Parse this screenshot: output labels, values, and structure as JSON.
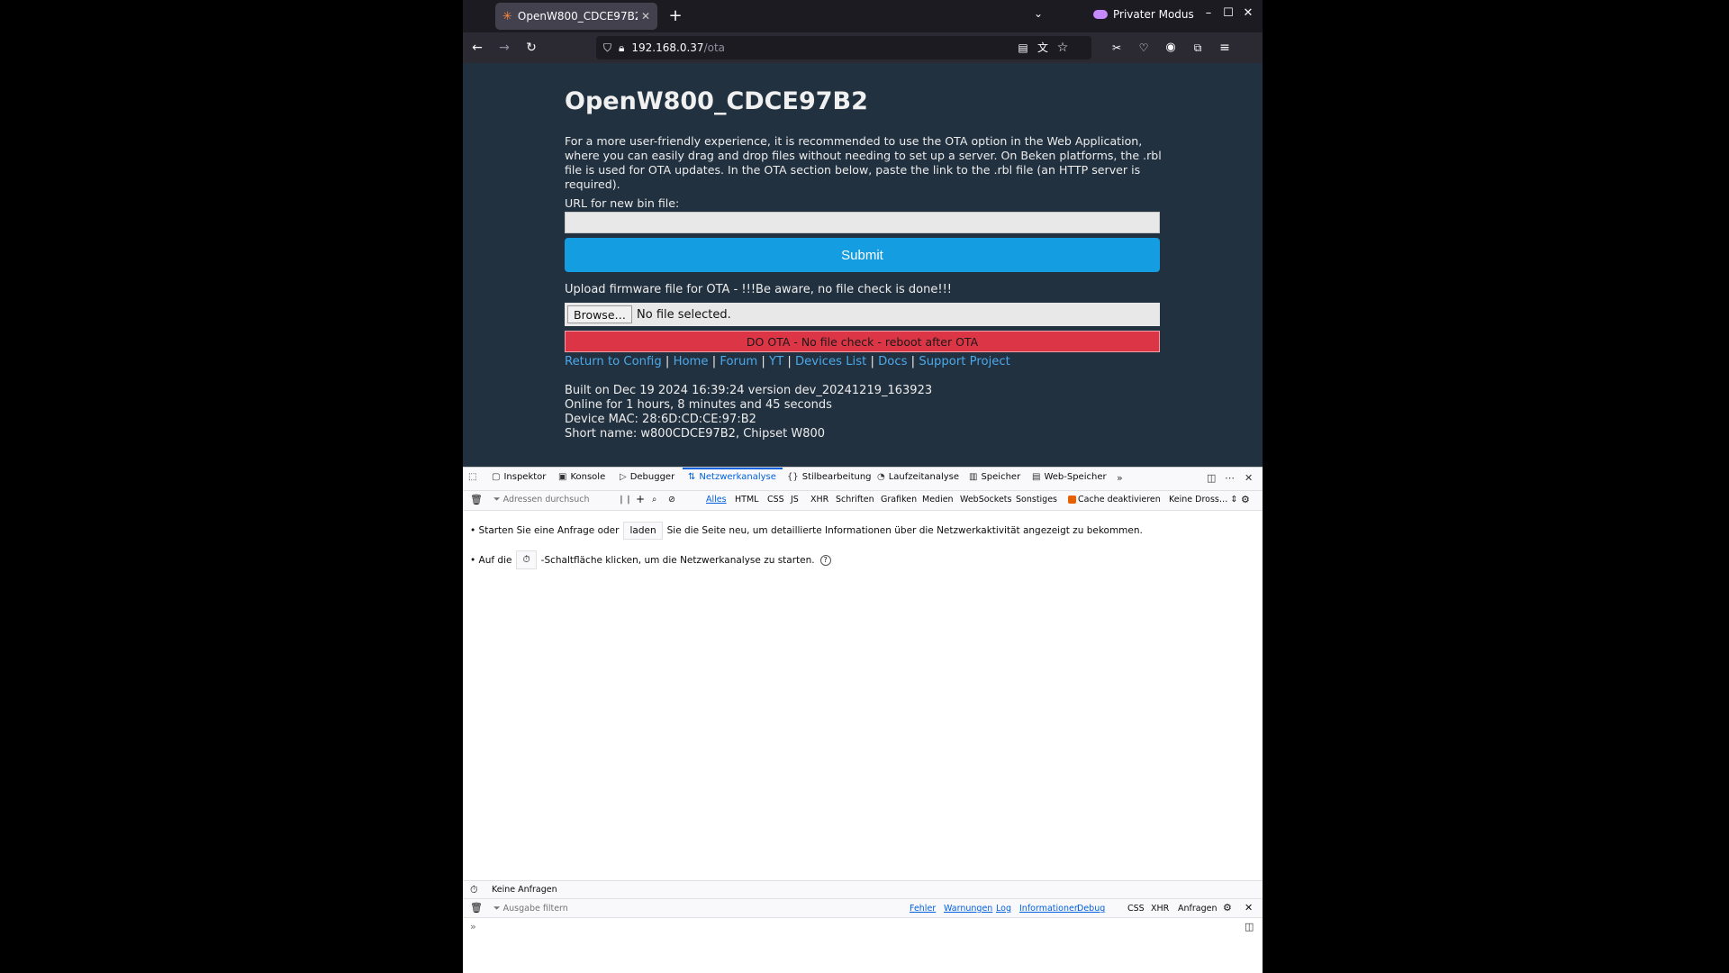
{
  "browser": {
    "tab_title": "OpenW800_CDCE97B2",
    "private_label": "Privater Modus",
    "url_host": "192.168.0.37",
    "url_path": "/ota"
  },
  "page": {
    "title": "OpenW800_CDCE97B2",
    "intro": "For a more user-friendly experience, it is recommended to use the OTA option in the Web Application, where you can easily drag and drop files without needing to set up a server. On Beken platforms, the .rbl file is used for OTA updates. In the OTA section below, paste the link to the .rbl file (an HTTP server is required).",
    "url_label": "URL for new bin file:",
    "url_value": "",
    "submit_label": "Submit",
    "upload_label": "Upload firmware file for OTA - !!!Be aware, no file check is done!!!",
    "browse_label": "Browse…",
    "no_file_label": "No file selected.",
    "do_ota_label": "DO OTA - No file check - reboot after OTA",
    "links": [
      "Return to Config",
      "Home",
      "Forum",
      "YT",
      "Devices List",
      "Docs",
      "Support Project"
    ],
    "separator": "|",
    "info": {
      "built": "Built on Dec 19 2024 16:39:24 version dev_20241219_163923",
      "online": "Online for 1 hours, 8 minutes and 45 seconds",
      "mac": "Device MAC: 28:6D:CD:CE:97:B2",
      "short": "Short name: w800CDCE97B2, Chipset W800"
    }
  },
  "devtools": {
    "tabs": [
      "Inspektor",
      "Konsole",
      "Debugger",
      "Netzwerkanalyse",
      "Stilbearbeitung",
      "Laufzeitanalyse",
      "Speicher",
      "Web-Speicher"
    ],
    "filter_placeholder": "Adressen durchsuch",
    "type_filters": [
      "Alles",
      "HTML",
      "CSS",
      "JS",
      "XHR",
      "Schriften",
      "Grafiken",
      "Medien",
      "WebSockets",
      "Sonstiges"
    ],
    "cache_label": "Cache deaktivieren",
    "throttle_label": "Keine Dross…",
    "msg1_pre": "• Starten Sie eine Anfrage oder",
    "msg1_btn": "laden",
    "msg1_post": "Sie die Seite neu, um detaillierte Informationen über die Netzwerkaktivität angezeigt zu bekommen.",
    "msg2_pre": "• Auf die",
    "msg2_post": "-Schaltfläche klicken, um die Netzwerkanalyse zu starten.",
    "status": "Keine Anfragen",
    "console_filter_placeholder": "Ausgabe filtern",
    "console_levels": [
      "Fehler",
      "Warnungen",
      "Log",
      "Informationen",
      "Debug"
    ],
    "console_extra": [
      "CSS",
      "XHR",
      "Anfragen"
    ]
  }
}
